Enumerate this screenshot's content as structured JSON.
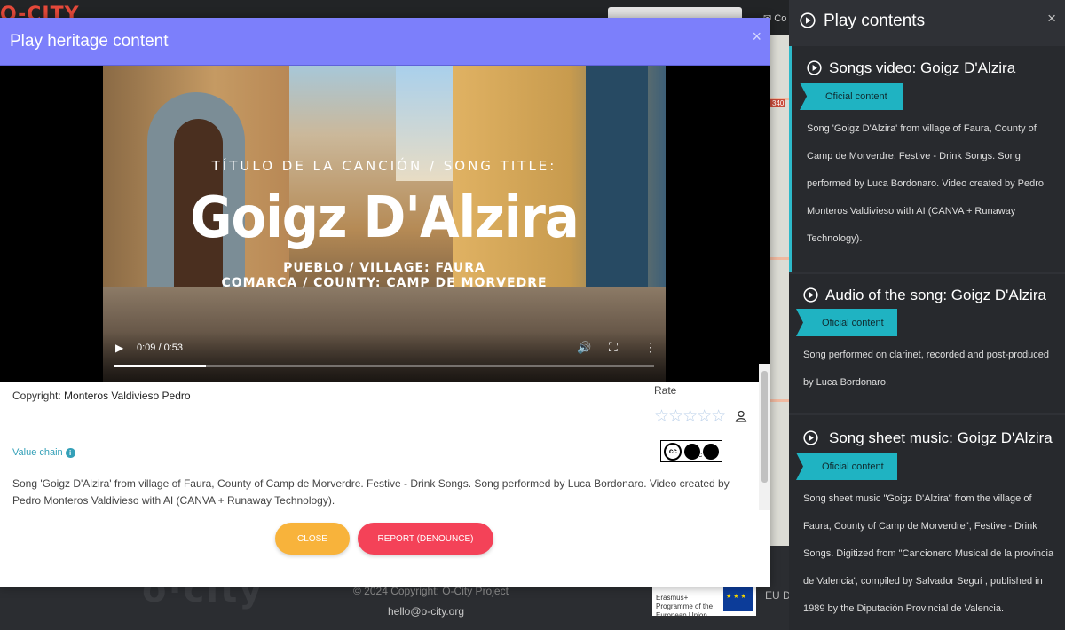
{
  "background": {
    "nav_fragment": "Co",
    "footer_copyright": "© 2024 Copyright: O-City Project",
    "footer_email": "hello@o-city.org",
    "eu_programme": "Erasmus+ Programme of the European Union",
    "eu_disclaimer": "EU Disclaimer",
    "map_label": "340"
  },
  "modal": {
    "title": "Play heritage content",
    "close_glyph": "×",
    "video": {
      "subtitle": "TÍTULO DE LA CANCIÓN / SONG TITLE:",
      "song_title": "Goigz D'Alzira",
      "village": "PUEBLO / VILLAGE: FAURA",
      "county": "COMARCA / COUNTY: CAMP DE MORVEDRE",
      "time": "0:09 / 0:53",
      "progress": 0.17
    },
    "copyright_label": "Copyright:",
    "copyright_value": "Monteros Valdivieso Pedro",
    "rate_label": "Rate",
    "rating": "☆☆☆☆☆",
    "license": "BY NC",
    "value_chain": "Value chain",
    "description": "Song 'Goigz D'Alzira' from village of Faura, County of Camp de Morverdre. Festive - Drink Songs. Song performed by Luca Bordonaro. Video created by Pedro Monteros Valdivieso with AI (CANVA + Runaway Technology).",
    "close_button": "CLOSE",
    "report_button": "REPORT (DENOUNCE)"
  },
  "side_panel": {
    "title": "Play contents",
    "close_glyph": "×",
    "items": [
      {
        "title": "Songs video: Goigz D'Alzira",
        "badge": "Oficial content",
        "description": "Song 'Goigz D'Alzira' from village of Faura, County of Camp de Morverdre. Festive - Drink Songs. Song performed by Luca Bordonaro. Video created by Pedro Monteros Valdivieso with AI (CANVA + Runaway Technology)."
      },
      {
        "title": "Audio of the song: Goigz D'Alzira",
        "badge": "Oficial content",
        "description": "Song performed on clarinet, recorded and post-produced by Luca Bordonaro."
      },
      {
        "title": "Song sheet music: Goigz D'Alzira",
        "badge": "Oficial content",
        "description": "Song sheet music \"Goigz D'Alzira\" from the village of Faura, County of Camp de Morverdre\", Festive - Drink Songs. Digitized from \"Cancionero Musical de la provincia de Valencia', compiled by Salvador Seguí , published in 1989 by the Diputación Provincial de Valencia."
      }
    ]
  },
  "colors": {
    "modal_header": "#7c7ffb",
    "accent_teal": "#1fb3c2",
    "close_button": "#f8b33b",
    "report_button": "#f44258",
    "side_bg": "#2f3136"
  }
}
